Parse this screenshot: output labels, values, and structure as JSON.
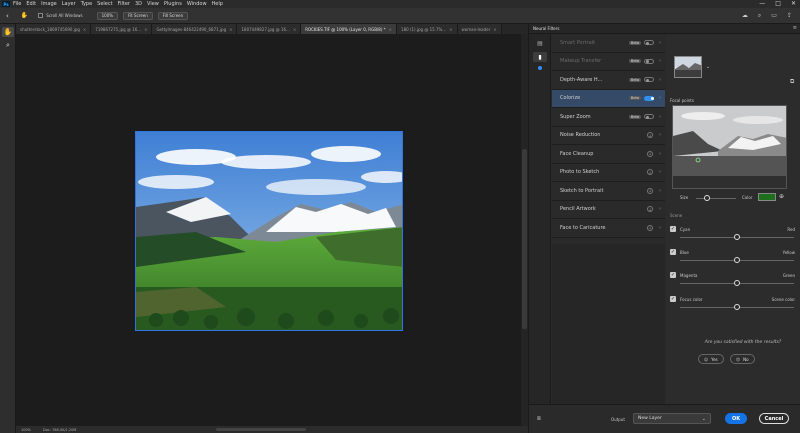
{
  "menu": [
    "File",
    "Edit",
    "Image",
    "Layer",
    "Type",
    "Select",
    "Filter",
    "3D",
    "View",
    "Plugins",
    "Window",
    "Help"
  ],
  "window_controls": {
    "min": "—",
    "max": "□",
    "close": "✕"
  },
  "options": {
    "scroll_all": "Scroll All Windows",
    "zoom100": "100%",
    "fit": "Fit Screen",
    "fill": "Fill Screen"
  },
  "tabs": [
    {
      "label": "shutterstock_1869745690.jpg",
      "active": false
    },
    {
      "label": "719867275.jpg @ 16...",
      "active": false
    },
    {
      "label": "GettyImages-846422490_6871.jpg",
      "active": false
    },
    {
      "label": "1807449827.jpg @ 16...",
      "active": false
    },
    {
      "label": "ROCKIES.TIF @ 100% (Layer 0, RGB/8) *",
      "active": true
    },
    {
      "label": "180 (1).jpg @ 15.7%...",
      "active": false
    },
    {
      "label": "woman-leader",
      "active": false
    }
  ],
  "status": {
    "zoom": "100%",
    "doc": "Doc: 768.0K/1.20M"
  },
  "panel": {
    "title": "Neural Filters",
    "filters": [
      {
        "label": "Smart Portrait",
        "beta": "Beta",
        "kind": "toggle",
        "on": false,
        "disabled": true
      },
      {
        "label": "Makeup Transfer",
        "beta": "Beta",
        "kind": "toggle",
        "on": false,
        "disabled": true
      },
      {
        "label": "Depth-Aware H...",
        "beta": "Beta",
        "kind": "toggle",
        "on": false,
        "disabled": false
      },
      {
        "label": "Colorize",
        "beta": "Beta",
        "kind": "toggle",
        "on": true,
        "disabled": false,
        "selected": true
      },
      {
        "label": "Super Zoom",
        "beta": "Beta",
        "kind": "toggle",
        "on": false,
        "disabled": false
      },
      {
        "label": "Noise Reduction",
        "beta": "",
        "kind": "download",
        "disabled": false
      },
      {
        "label": "Face Cleanup",
        "beta": "",
        "kind": "download",
        "disabled": false
      },
      {
        "label": "Photo to Sketch",
        "beta": "",
        "kind": "download",
        "disabled": false
      },
      {
        "label": "Sketch to Portrait",
        "beta": "",
        "kind": "download",
        "disabled": false
      },
      {
        "label": "Pencil Artwork",
        "beta": "",
        "kind": "download",
        "disabled": false
      },
      {
        "label": "Face to Caricature",
        "beta": "",
        "kind": "download",
        "disabled": false
      }
    ],
    "focal_points": "Focal points",
    "size_label": "Size",
    "color_label": "Color",
    "swatch_color": "#1e6e1e",
    "scene_label": "Scene",
    "sliders": [
      {
        "left": "Cyan",
        "right": "Red",
        "checked": true,
        "level": 0.5
      },
      {
        "left": "Blue",
        "right": "Yellow",
        "checked": true,
        "level": 0.5
      },
      {
        "left": "Magenta",
        "right": "Green",
        "checked": true,
        "level": 0.5
      },
      {
        "left": "Focus color",
        "right": "Scene color",
        "checked": true,
        "level": 0.5
      }
    ],
    "size_level": 0.28,
    "question": "Are you satisfied with the results?",
    "yes": "Yes",
    "no": "No",
    "output_label": "Output",
    "output_value": "New Layer",
    "ok": "OK",
    "cancel": "Cancel"
  }
}
